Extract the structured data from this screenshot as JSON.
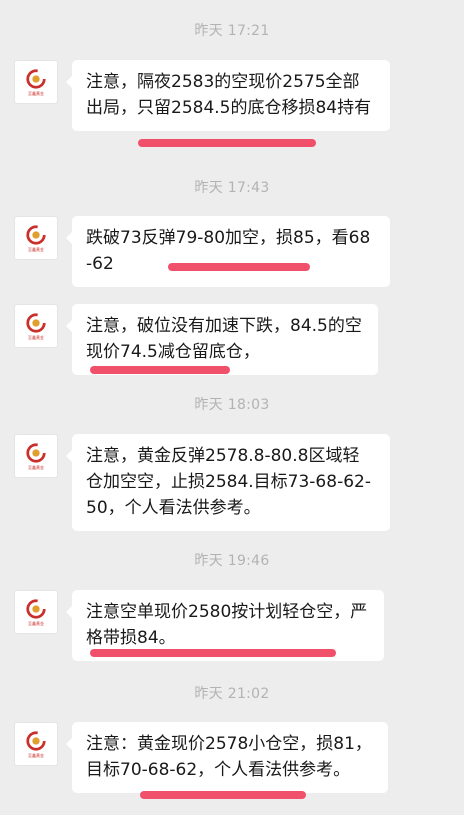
{
  "messages": [
    {
      "time": "昨天 17:21",
      "text": "注意，隔夜2583的空现价2575全部出局，只留2584.5的底仓移损84持有"
    },
    {
      "time": "昨天 17:43",
      "text": "跌破73反弹79-80加空，损85，看68-62"
    },
    {
      "time": "",
      "text": "注意，破位没有加速下跌，84.5的空现价74.5减仓留底仓，"
    },
    {
      "time": "昨天 18:03",
      "text": "注意，黄金反弹2578.8-80.8区域轻仓加空空，止损2584.目标73-68-62-50，个人看法供参考。"
    },
    {
      "time": "昨天 19:46",
      "text": "注意空单现价2580按计划轻仓空，严格带损84。"
    },
    {
      "time": "昨天 21:02",
      "text": "注意：黄金现价2578小仓空，损81，目标70-68-62，个人看法供参考。"
    }
  ],
  "avatar": {
    "caption": "至鑫黄金",
    "brand_color": "#c9302c"
  },
  "colors": {
    "background": "#ededed",
    "bubble": "#ffffff",
    "time": "#b3b3b3",
    "highlight": "#f0506a"
  }
}
